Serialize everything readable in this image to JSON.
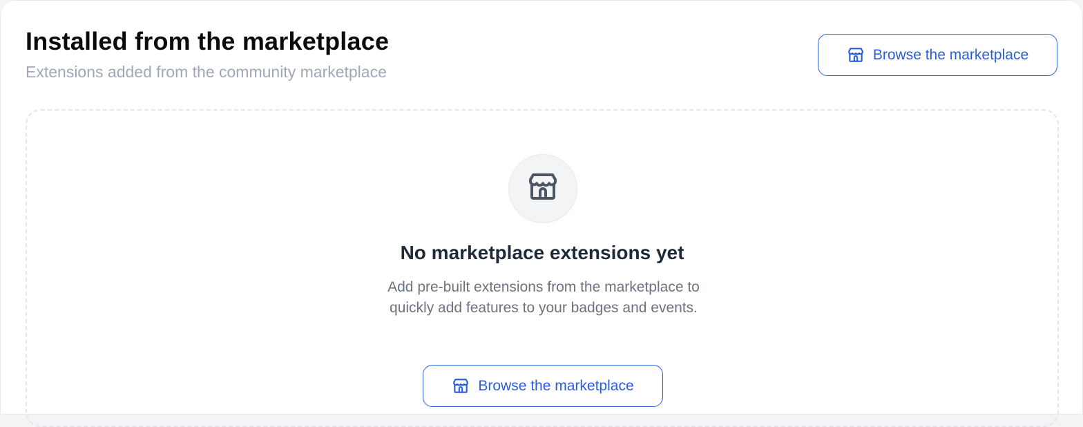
{
  "section": {
    "title": "Installed from the marketplace",
    "subtitle": "Extensions added from the community marketplace",
    "browse_button_label": "Browse the marketplace",
    "browse_button_icon": "store-icon"
  },
  "empty_state": {
    "icon": "store-icon",
    "title": "No marketplace extensions yet",
    "description": "Add pre-built extensions from the marketplace to quickly add features to your badges and events.",
    "button_label": "Browse the marketplace",
    "button_icon": "store-icon"
  },
  "colors": {
    "accent": "#2b5fd9",
    "title": "#0b0b0f",
    "subtitle": "#a0a8b8",
    "empty_title": "#1f2937",
    "empty_desc": "#6b7280",
    "icon": "#4b5563"
  }
}
